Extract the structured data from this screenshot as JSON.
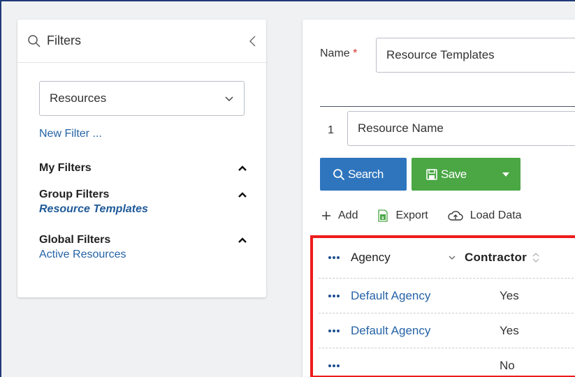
{
  "filters": {
    "title": "Filters",
    "selected_type": "Resources",
    "new_filter_label": "New Filter ...",
    "sections": [
      {
        "label": "My Filters",
        "items": []
      },
      {
        "label": "Group Filters",
        "items": [
          "Resource Templates"
        ]
      },
      {
        "label": "Global Filters",
        "items": [
          "Active Resources"
        ]
      }
    ]
  },
  "form": {
    "name_label": "Name",
    "required_mark": "*",
    "name_value": "Resource Templates",
    "row_number": "1",
    "field_value": "Resource Name",
    "search_label": "Search",
    "save_label": "Save"
  },
  "toolbar": {
    "add_label": "Add",
    "export_label": "Export",
    "load_label": "Load Data"
  },
  "grid": {
    "columns": [
      "Agency",
      "Contractor"
    ],
    "rows": [
      {
        "agency": "Default Agency",
        "contractor": "Yes"
      },
      {
        "agency": "Default Agency",
        "contractor": "Yes"
      },
      {
        "agency": "",
        "contractor": "No"
      }
    ]
  },
  "colors": {
    "link": "#2563a6",
    "search_button": "#2f75bd",
    "save_button": "#4aa744",
    "highlight": "#ee1c1c"
  },
  "icons": [
    "search-icon",
    "collapse-chevron-icon",
    "chevron-down-icon",
    "caret-up-icon",
    "save-icon",
    "plus-icon",
    "excel-icon",
    "cloud-upload-icon",
    "more-dots-icon",
    "sort-icon"
  ]
}
